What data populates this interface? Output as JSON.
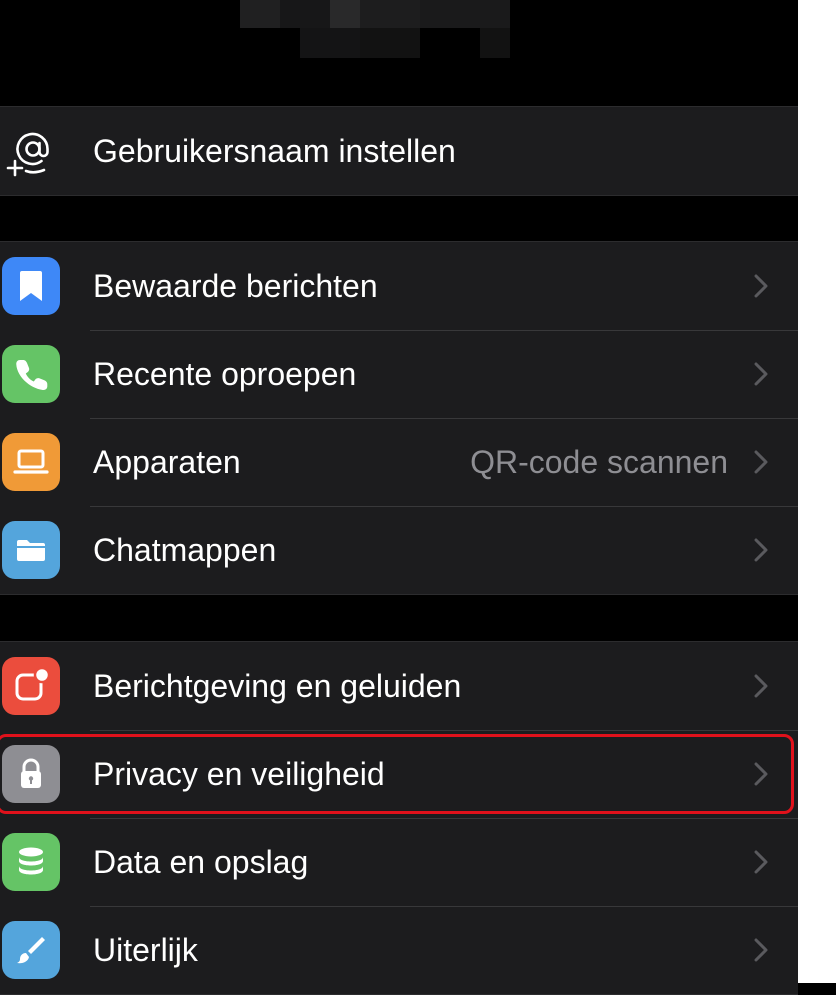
{
  "profile": {
    "username_row": {
      "label": "Gebruikersnaam instellen",
      "icon": "at-plus-icon"
    }
  },
  "group_main": {
    "items": [
      {
        "label": "Bewaarde berichten",
        "icon": "bookmark-icon",
        "color": "#3e88f7"
      },
      {
        "label": "Recente oproepen",
        "icon": "phone-icon",
        "color": "#65c466"
      },
      {
        "label": "Apparaten",
        "detail": "QR-code scannen",
        "icon": "laptop-icon",
        "color": "#f09a37"
      },
      {
        "label": "Chatmappen",
        "icon": "folder-icon",
        "color": "#54a5dc"
      }
    ]
  },
  "group_settings": {
    "items": [
      {
        "label": "Berichtgeving en geluiden",
        "icon": "notification-badge-icon",
        "color": "#eb4d3d"
      },
      {
        "label": "Privacy en veiligheid",
        "icon": "lock-icon",
        "color": "#8e8e93",
        "highlighted": true
      },
      {
        "label": "Data en opslag",
        "icon": "database-icon",
        "color": "#65c466"
      },
      {
        "label": "Uiterlijk",
        "icon": "brush-icon",
        "color": "#54a5dc"
      }
    ]
  },
  "colors": {
    "background": "#000000",
    "cell": "#1c1c1e",
    "separator": "#38383a",
    "secondary_text": "#8e8e93",
    "highlight": "#e0111b"
  }
}
